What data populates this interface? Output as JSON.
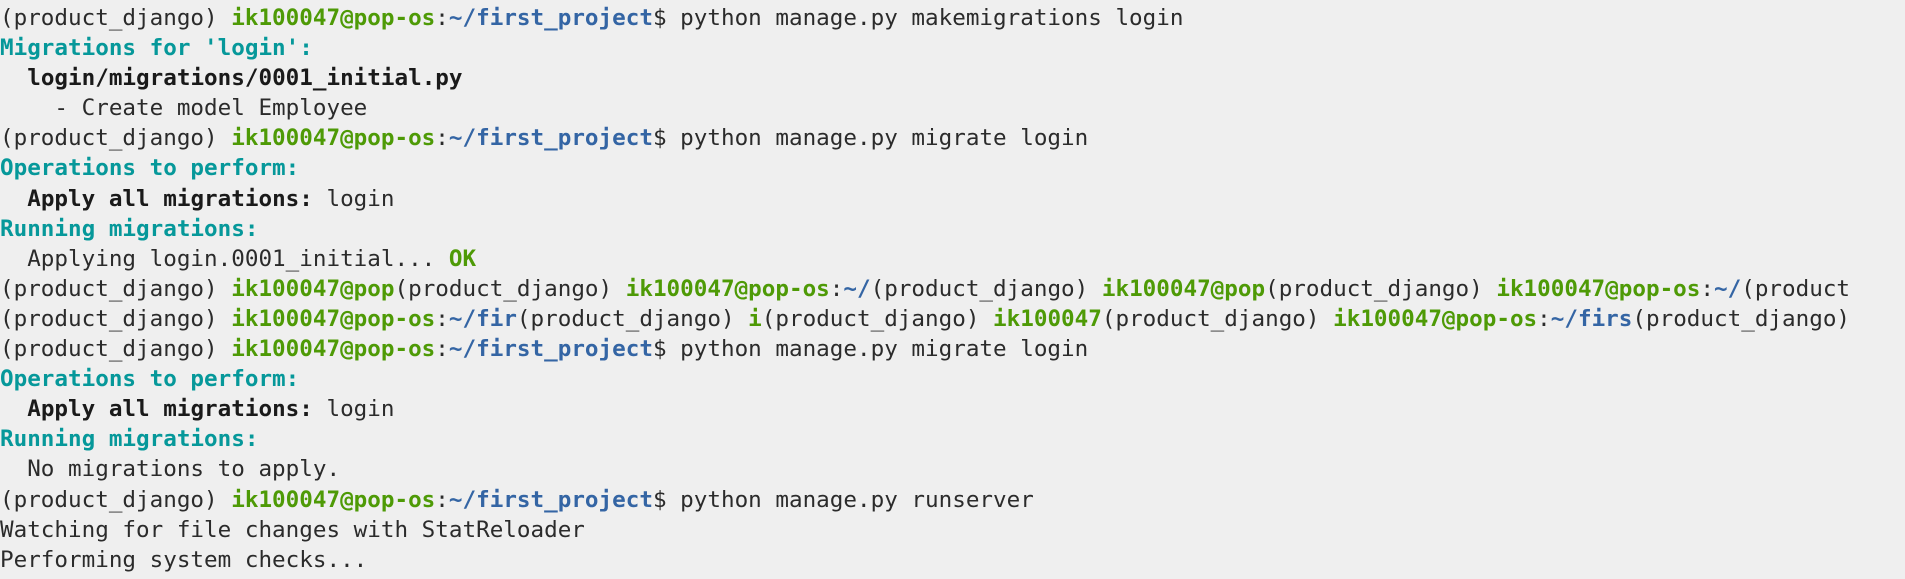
{
  "terminal": {
    "lines": [
      [
        [
          "plain",
          "(product_django) "
        ],
        [
          "green",
          "ik100047@pop-os"
        ],
        [
          "plain",
          ":"
        ],
        [
          "blue",
          "~/first_project"
        ],
        [
          "plain",
          "$ python manage.py makemigrations login"
        ]
      ],
      [
        [
          "cyan",
          "Migrations for 'login':"
        ]
      ],
      [
        [
          "plain",
          "  "
        ],
        [
          "bold",
          "login/migrations/0001_initial.py"
        ]
      ],
      [
        [
          "plain",
          "    - Create model Employee"
        ]
      ],
      [
        [
          "plain",
          "(product_django) "
        ],
        [
          "green",
          "ik100047@pop-os"
        ],
        [
          "plain",
          ":"
        ],
        [
          "blue",
          "~/first_project"
        ],
        [
          "plain",
          "$ python manage.py migrate login"
        ]
      ],
      [
        [
          "cyan",
          "Operations to perform:"
        ]
      ],
      [
        [
          "plain",
          "  "
        ],
        [
          "bold",
          "Apply all migrations:"
        ],
        [
          "plain",
          " login"
        ]
      ],
      [
        [
          "cyan",
          "Running migrations:"
        ]
      ],
      [
        [
          "plain",
          "  Applying login.0001_initial... "
        ],
        [
          "ok",
          "OK"
        ]
      ],
      [
        [
          "plain",
          "(product_django) "
        ],
        [
          "green",
          "ik100047@pop"
        ],
        [
          "plain",
          "(product_django) "
        ],
        [
          "green",
          "ik100047@pop-os"
        ],
        [
          "plain",
          ":"
        ],
        [
          "blue",
          "~/"
        ],
        [
          "plain",
          "(product_django) "
        ],
        [
          "green",
          "ik100047@pop"
        ],
        [
          "plain",
          "(product_django) "
        ],
        [
          "green",
          "ik100047@pop-os"
        ],
        [
          "plain",
          ":"
        ],
        [
          "blue",
          "~/"
        ],
        [
          "plain",
          "(product"
        ]
      ],
      [
        [
          "plain",
          "(product_django) "
        ],
        [
          "green",
          "ik100047@pop-os"
        ],
        [
          "plain",
          ":"
        ],
        [
          "blue",
          "~/fir"
        ],
        [
          "plain",
          "(product_django) "
        ],
        [
          "green",
          "i"
        ],
        [
          "plain",
          "(product_django) "
        ],
        [
          "green",
          "ik100047"
        ],
        [
          "plain",
          "(product_django) "
        ],
        [
          "green",
          "ik100047@pop-os"
        ],
        [
          "plain",
          ":"
        ],
        [
          "blue",
          "~/firs"
        ],
        [
          "plain",
          "(product_django)"
        ]
      ],
      [
        [
          "plain",
          "(product_django) "
        ],
        [
          "green",
          "ik100047@pop-os"
        ],
        [
          "plain",
          ":"
        ],
        [
          "blue",
          "~/first_project"
        ],
        [
          "plain",
          "$ python manage.py migrate login"
        ]
      ],
      [
        [
          "cyan",
          "Operations to perform:"
        ]
      ],
      [
        [
          "plain",
          "  "
        ],
        [
          "bold",
          "Apply all migrations:"
        ],
        [
          "plain",
          " login"
        ]
      ],
      [
        [
          "cyan",
          "Running migrations:"
        ]
      ],
      [
        [
          "plain",
          "  No migrations to apply."
        ]
      ],
      [
        [
          "plain",
          "(product_django) "
        ],
        [
          "green",
          "ik100047@pop-os"
        ],
        [
          "plain",
          ":"
        ],
        [
          "blue",
          "~/first_project"
        ],
        [
          "plain",
          "$ python manage.py runserver"
        ]
      ],
      [
        [
          "plain",
          "Watching for file changes with StatReloader"
        ]
      ],
      [
        [
          "plain",
          "Performing system checks..."
        ]
      ]
    ],
    "colors": {
      "background": "#efefef",
      "text": "#2b2b2b",
      "user_host": "#4e9a06",
      "path": "#3465a4",
      "heading": "#06989a",
      "ok": "#4e9a06"
    }
  }
}
